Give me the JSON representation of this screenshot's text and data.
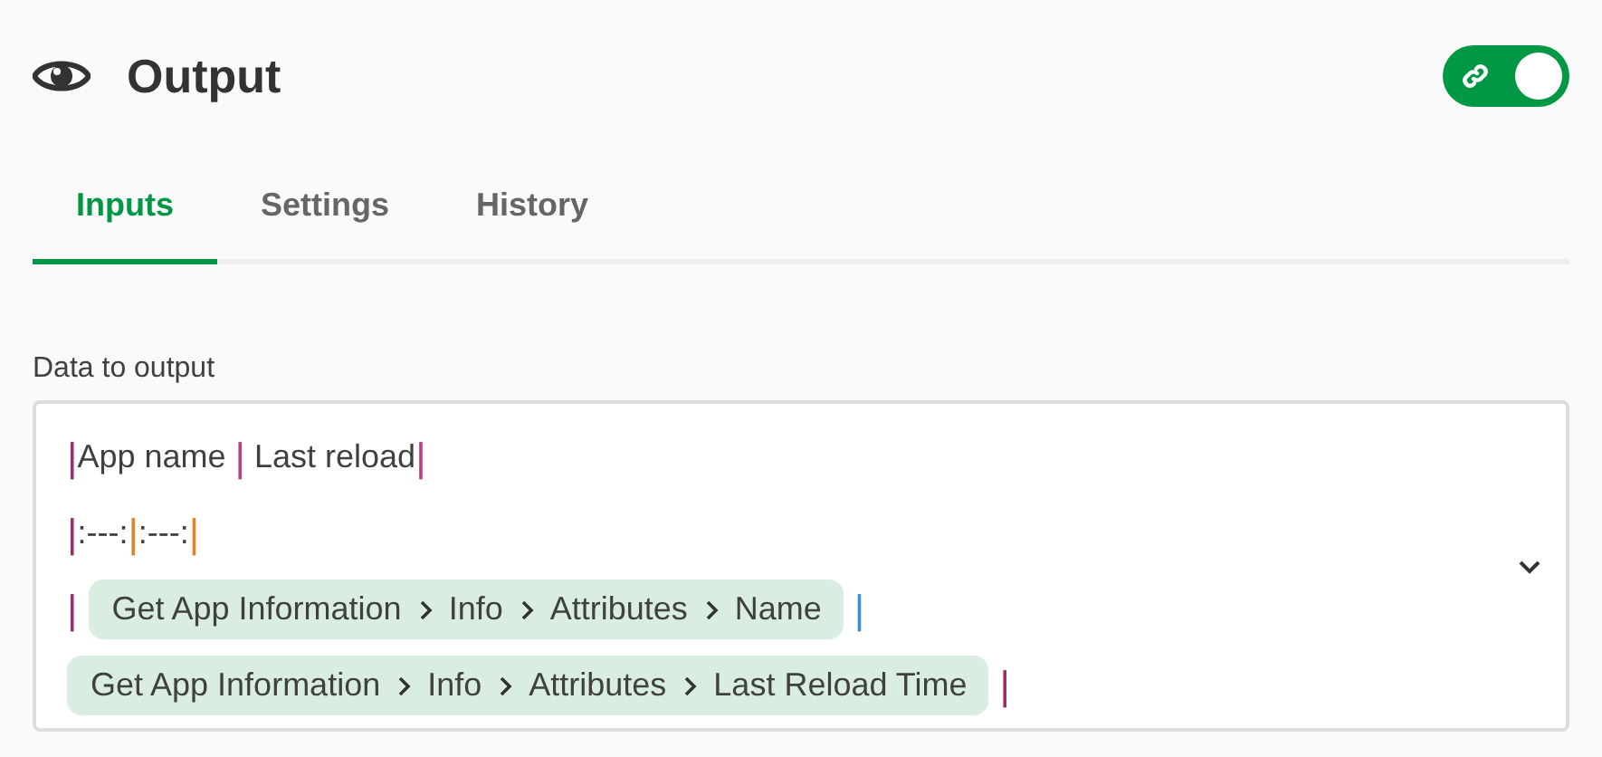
{
  "header": {
    "title": "Output",
    "toggle": {
      "on": true
    }
  },
  "tabs": [
    {
      "label": "Inputs",
      "selected": true
    },
    {
      "label": "Settings",
      "selected": false
    },
    {
      "label": "History",
      "selected": false
    }
  ],
  "field": {
    "label": "Data to output",
    "lines": [
      {
        "segments": [
          {
            "kind": "pipe",
            "text": "|",
            "color": "#9c2d6b"
          },
          {
            "kind": "text",
            "text": "App name "
          },
          {
            "kind": "pipe",
            "text": "|",
            "color": "#c23b7e"
          },
          {
            "kind": "text",
            "text": " Last reload"
          },
          {
            "kind": "pipe",
            "text": "|",
            "color": "#c23b7e"
          }
        ]
      },
      {
        "segments": [
          {
            "kind": "pipe",
            "text": "|",
            "color": "#9c2d6b"
          },
          {
            "kind": "text",
            "text": ":---:"
          },
          {
            "kind": "pipe",
            "text": "|",
            "color": "#e0842a"
          },
          {
            "kind": "text",
            "text": ":---:"
          },
          {
            "kind": "pipe",
            "text": "|",
            "color": "#e0842a"
          }
        ]
      },
      {
        "segments": [
          {
            "kind": "pipe",
            "text": "|",
            "color": "#9c2d6b"
          },
          {
            "kind": "pill",
            "path": [
              "Get App Information",
              "Info",
              "Attributes",
              "Name"
            ]
          },
          {
            "kind": "pipe",
            "text": "|",
            "color": "#3c8fd4"
          }
        ]
      },
      {
        "segments": [
          {
            "kind": "pill",
            "path": [
              "Get App Information",
              "Info",
              "Attributes",
              "Last Reload Time"
            ]
          },
          {
            "kind": "pipe",
            "text": "|",
            "color": "#9c2d6b"
          }
        ]
      }
    ]
  }
}
